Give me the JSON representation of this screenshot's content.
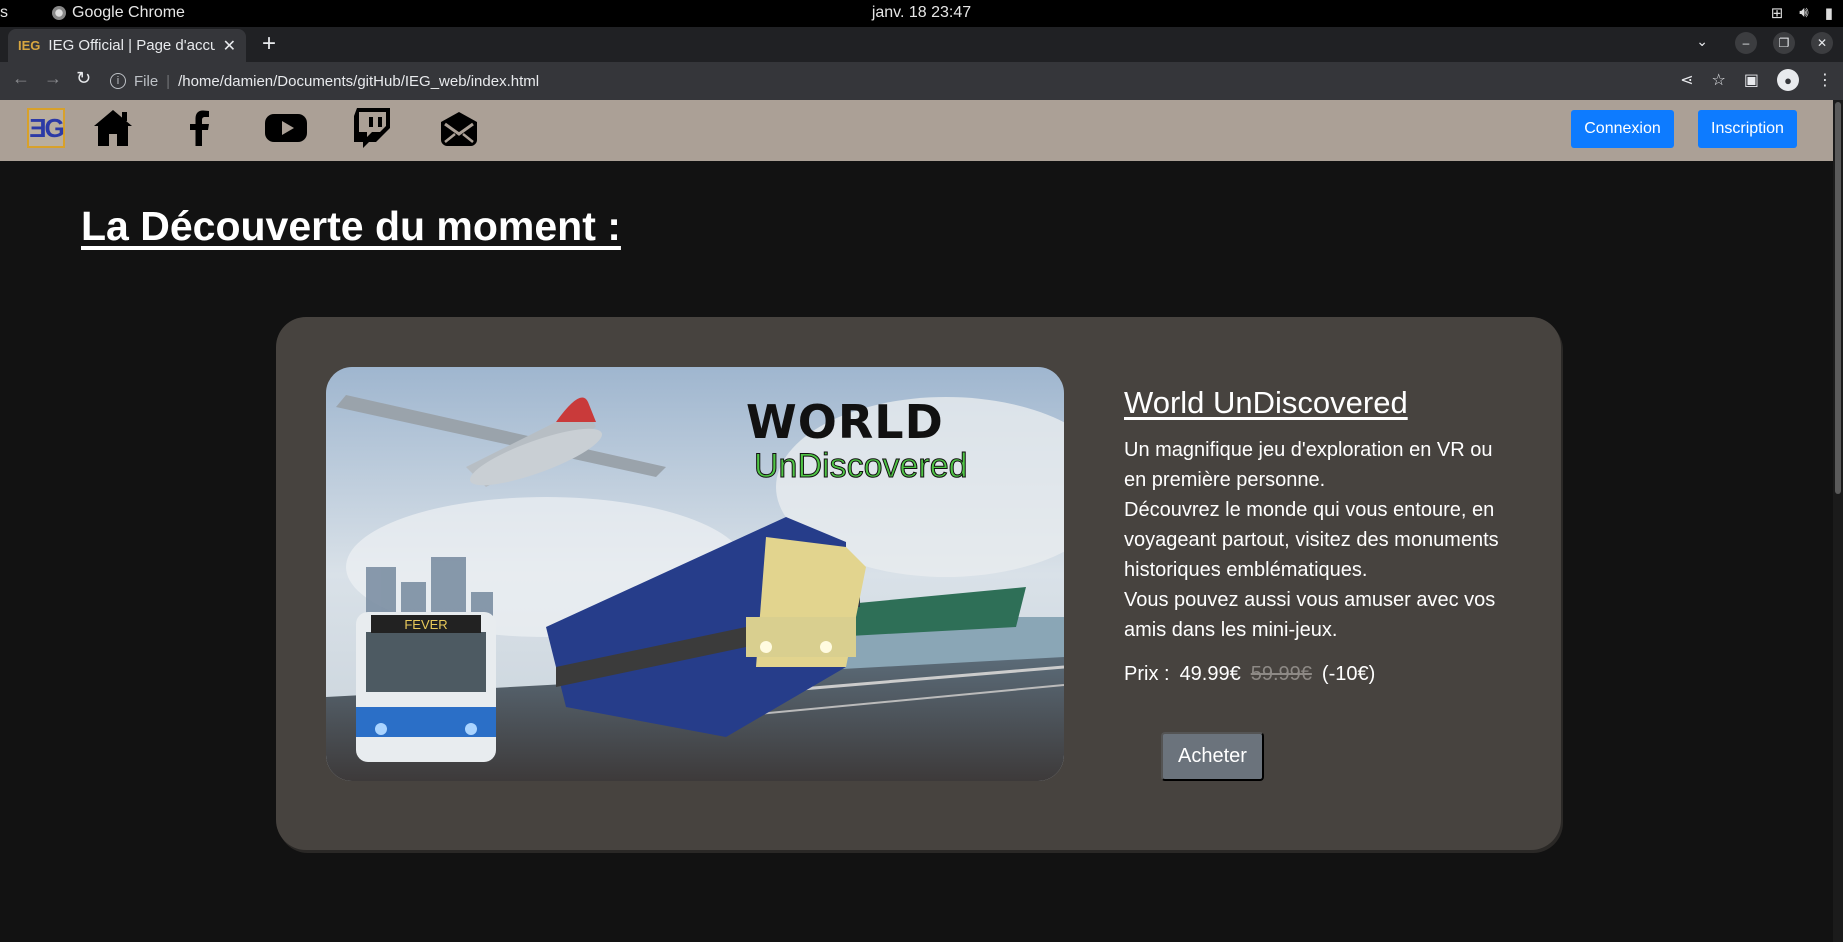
{
  "os": {
    "app_name": "Google Chrome",
    "left_fragment": "s",
    "clock": "janv. 18  23:47"
  },
  "browser": {
    "tab_title": "IEG Official | Page d'accueil",
    "tab_favicon": "IEG",
    "url_scheme": "File",
    "url_separator": "|",
    "url": "/home/damien/Documents/gitHub/IEG_web/index.html"
  },
  "site": {
    "logo_text": "ƎG",
    "nav_icons": [
      "home-icon",
      "facebook-icon",
      "youtube-icon",
      "twitch-icon",
      "mail-icon"
    ],
    "login_label": "Connexion",
    "signup_label": "Inscription",
    "nav_color": "#aba096",
    "accent_blue": "#0d7bff"
  },
  "main": {
    "heading": "La Découverte du moment :",
    "card": {
      "image_logo_line1": "WORLD",
      "image_logo_line2": "UnDiscovered",
      "image_bus_sign": "FEVER",
      "title": "World UnDiscovered",
      "description": [
        "Un magnifique jeu d'exploration en VR ou en première personne.",
        "Découvrez le monde qui vous entoure, en voyageant partout, visitez des monuments historiques emblématiques.",
        "Vous pouvez aussi vous amuser avec vos amis dans les mini-jeux."
      ],
      "price_label": "Prix :",
      "price_current": "49.99€",
      "price_old": "59.99€",
      "discount": "(-10€)",
      "buy_label": "Acheter"
    }
  }
}
